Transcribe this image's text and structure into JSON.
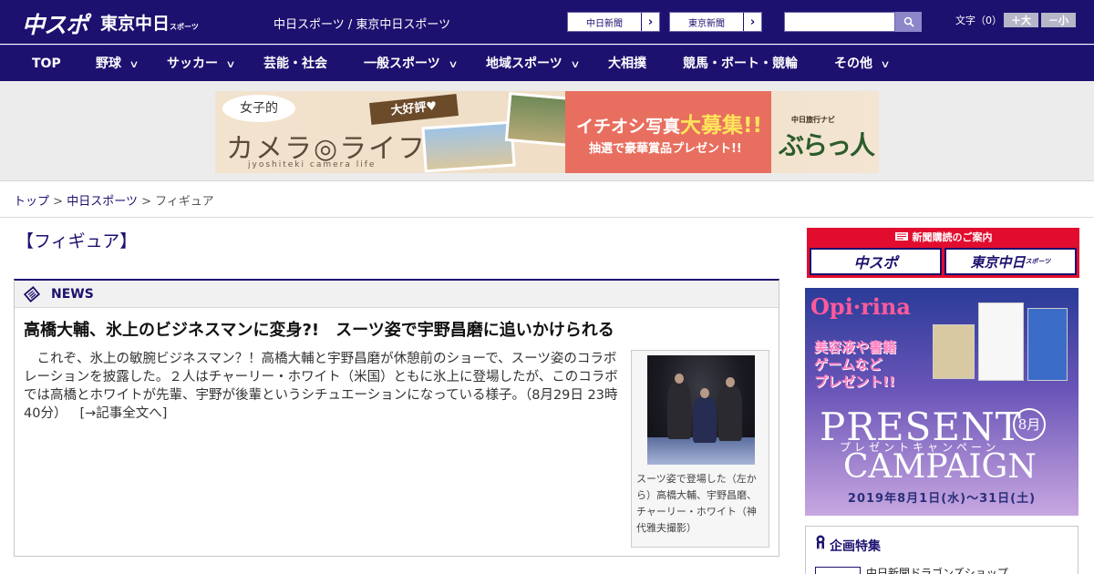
{
  "header": {
    "logo_chuspo": "中スポ",
    "logo_tokyo": "東京中日",
    "logo_tokyo_suffix": "スポーツ",
    "site_names": "中日スポーツ / 東京中日スポーツ",
    "paper_links": [
      "中日新聞",
      "東京新聞"
    ],
    "search": {
      "placeholder": "",
      "icon": "search-icon"
    },
    "font_size_label": "文字（0）",
    "font_larger": "＋大",
    "font_smaller": "－小"
  },
  "nav": {
    "items": [
      {
        "label": "TOP",
        "has_menu": false
      },
      {
        "label": "野球",
        "has_menu": true
      },
      {
        "label": "サッカー",
        "has_menu": true
      },
      {
        "label": "芸能・社会",
        "has_menu": false
      },
      {
        "label": "一般スポーツ",
        "has_menu": true
      },
      {
        "label": "地域スポーツ",
        "has_menu": true
      },
      {
        "label": "大相撲",
        "has_menu": false
      },
      {
        "label": "競馬・ボート・競輪",
        "has_menu": false
      },
      {
        "label": "その他",
        "has_menu": true
      }
    ]
  },
  "banner": {
    "bubble": "女子的",
    "title": "カメラ◎ライフ",
    "romaji": "jyoshiteki camera life",
    "ribbon": "大好評♥",
    "headline_pre": "イチオシ写真",
    "headline_em": "大募集!!",
    "sub": "抽選で豪華賞品プレゼント!!",
    "sponsor_caption": "中日旅行ナビ",
    "sponsor_logo": "ぶらっ人"
  },
  "breadcrumb": {
    "items": [
      "トップ",
      "中日スポーツ",
      "フィギュア"
    ],
    "separator": ">"
  },
  "main": {
    "page_title": "【フィギュア】",
    "news_label": "NEWS",
    "headline": "高橋大輔、氷上のビジネスマンに変身?!　スーツ姿で宇野昌磨に追いかけられる",
    "body": "これぞ、氷上の敏腕ビジネスマン？！高橋大輔と宇野昌磨が休憩前のショーで、スーツ姿のコラボレーションを披露した。２人はチャーリー・ホワイト（米国）ともに氷上に登場したが、このコラボでは高橋とホワイトが先輩、宇野が後輩というシチュエーションになっている様子。（8月29日 23時40分）",
    "read_more": "[→記事全文へ]",
    "photo_caption": "スーツ姿で登場した（左から）高橋大輔、宇野昌磨、チャーリー・ホワイト（神代雅夫撮影）"
  },
  "sidebar": {
    "subscribe_title": "新聞購読のご案内",
    "subscribe_links": [
      "中スポ",
      "東京中日"
    ],
    "subscribe_suffix": "スポーツ",
    "ad": {
      "brand": "Opi·rina",
      "pink_text": "美容液や書籍\nゲームなど\nプレゼント!!",
      "present": "PRESENT",
      "kana": "プレゼントキャンペーン",
      "campaign": "CAMPAIGN",
      "month": "8月",
      "dates": "2019年8月1日(水)〜31日(土)"
    },
    "feature_title": "企画特集",
    "feature_item": "中日新聞ドラゴンズショップ"
  },
  "colors": {
    "brand_navy": "#1c116f",
    "red": "#e20d2e",
    "gray_band": "#ececec"
  }
}
